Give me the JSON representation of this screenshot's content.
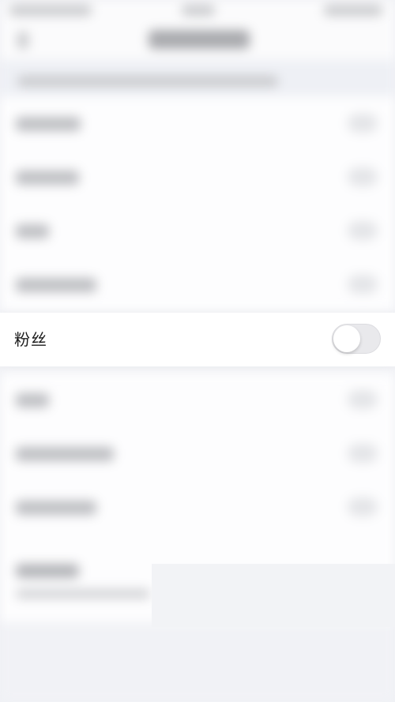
{
  "focused_setting": {
    "label": "粉丝",
    "toggle_on": false
  },
  "colors": {
    "background": "#f0f1f5",
    "row_background": "#ffffff",
    "toggle_off_track": "#e9e9ec",
    "label_text": "#1b1b1b"
  }
}
